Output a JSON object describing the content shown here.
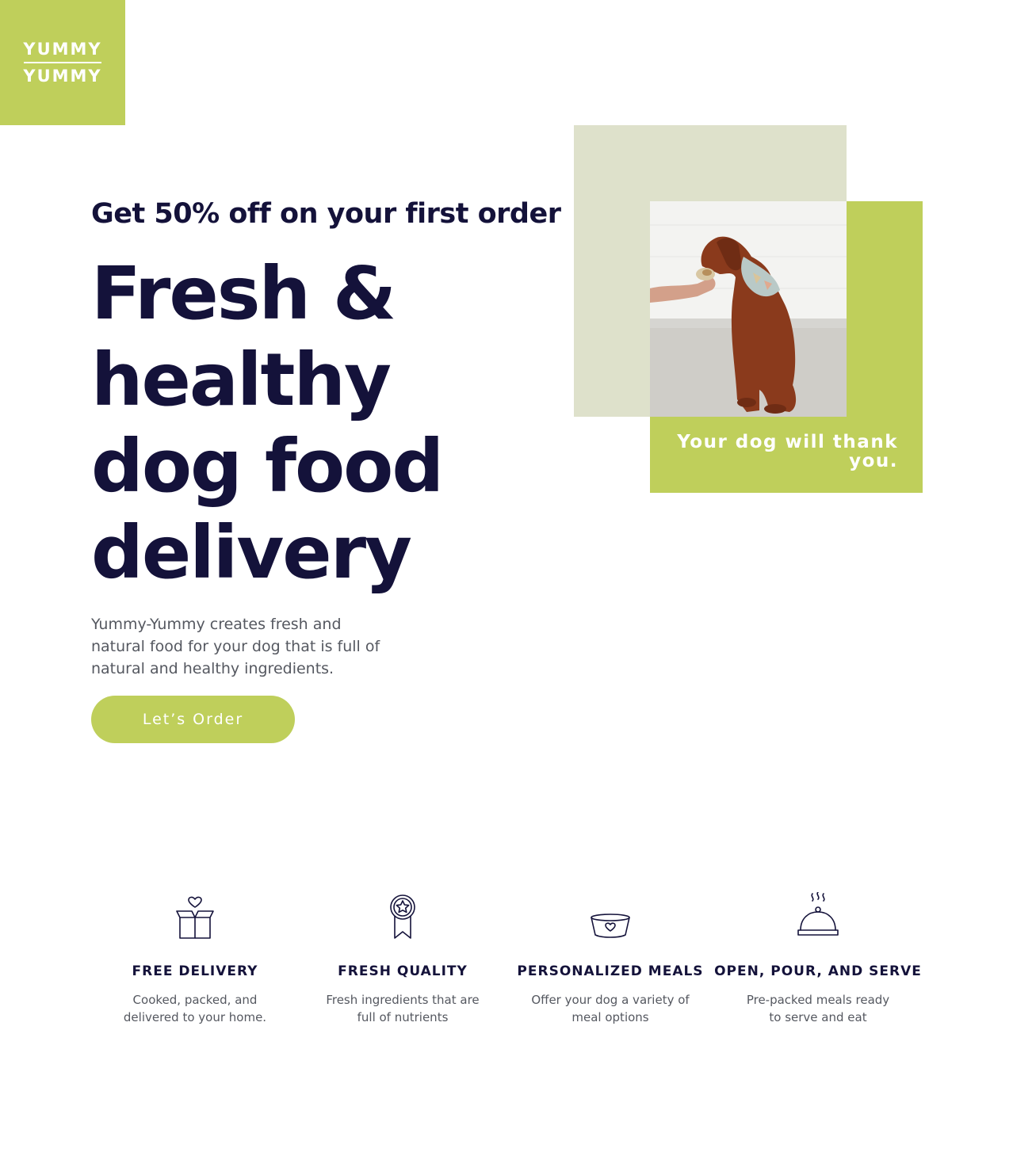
{
  "colors": {
    "accent": "#bfcf5b",
    "sage": "#dee1cb",
    "navy": "#14123a",
    "body_text": "#555860"
  },
  "logo": {
    "line1": "YUMMY",
    "line2": "YUMMY"
  },
  "hero": {
    "promo": "Get 50% off on your first order",
    "headline": "Fresh & healthy dog food delivery",
    "description": "Yummy-Yummy creates fresh and natural food for your dog that is full of natural and healthy ingredients.",
    "cta_label": "Let’s Order",
    "caption": "Your dog will thank you."
  },
  "features": [
    {
      "icon": "gift-box-heart-icon",
      "title": "FREE DELIVERY",
      "text": "Cooked, packed, and delivered to your home."
    },
    {
      "icon": "award-ribbon-star-icon",
      "title": "FRESH QUALITY",
      "text": "Fresh ingredients that are full of nutrients"
    },
    {
      "icon": "dog-bowl-heart-icon",
      "title": "PERSONALIZED MEALS",
      "text": "Offer your dog a variety of meal options"
    },
    {
      "icon": "serving-cloche-icon",
      "title": "OPEN, POUR, AND SERVE",
      "text": "Pre-packed meals ready to serve and eat"
    }
  ]
}
